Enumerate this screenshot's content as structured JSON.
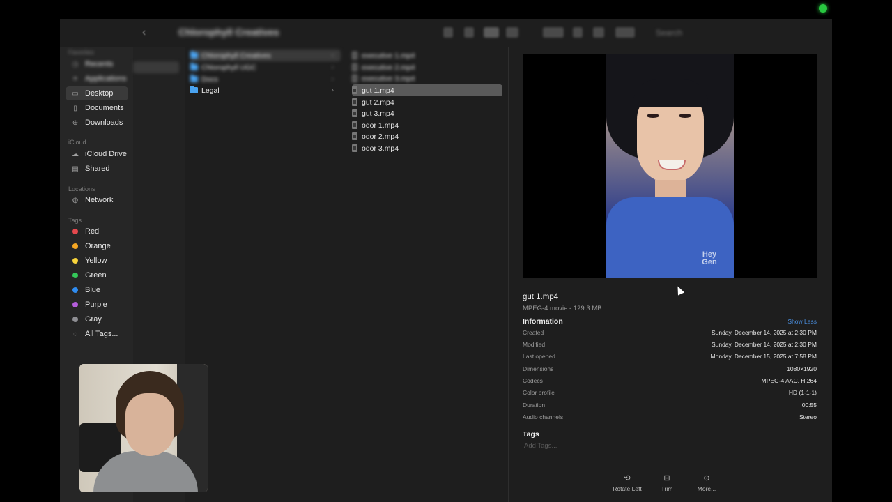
{
  "toolbar": {
    "folder_title": "Chlorophyll Creatives",
    "search_placeholder": "Search"
  },
  "sidebar": {
    "favorites_label": "Favorites",
    "favorites": [
      {
        "label": "Recents",
        "icon": "clock-icon"
      },
      {
        "label": "Applications",
        "icon": "applications-icon"
      },
      {
        "label": "Desktop",
        "icon": "desktop-icon"
      },
      {
        "label": "Documents",
        "icon": "document-icon"
      },
      {
        "label": "Downloads",
        "icon": "download-icon"
      }
    ],
    "icloud_label": "iCloud",
    "icloud": [
      {
        "label": "iCloud Drive",
        "icon": "cloud-icon"
      },
      {
        "label": "Shared",
        "icon": "shared-folder-icon"
      }
    ],
    "locations_label": "Locations",
    "locations": [
      {
        "label": "Network",
        "icon": "network-icon"
      }
    ],
    "tags_label": "Tags",
    "tags": [
      {
        "label": "Red",
        "color": "#e5484d"
      },
      {
        "label": "Orange",
        "color": "#f5a623"
      },
      {
        "label": "Yellow",
        "color": "#f7d33b"
      },
      {
        "label": "Green",
        "color": "#34c759"
      },
      {
        "label": "Blue",
        "color": "#2f8cf0"
      },
      {
        "label": "Purple",
        "color": "#b45ddb"
      },
      {
        "label": "Gray",
        "color": "#8e8e93"
      },
      {
        "label": "All Tags...",
        "icon": "tag-outline-icon"
      }
    ]
  },
  "column2": [
    {
      "label": "Chlorophyll Creatives",
      "blurred": true
    },
    {
      "label": "Chlorophyll UGC",
      "blurred": true
    },
    {
      "label": "Docs",
      "blurred": true
    },
    {
      "label": "Legal",
      "blurred": false
    }
  ],
  "column3": [
    {
      "label": "executive 1.mp4",
      "blurred": true
    },
    {
      "label": "executive 2.mp4",
      "blurred": true
    },
    {
      "label": "executive 3.mp4",
      "blurred": true
    },
    {
      "label": "gut 1.mp4",
      "selected": true
    },
    {
      "label": "gut 2.mp4"
    },
    {
      "label": "gut 3.mp4"
    },
    {
      "label": "odor 1.mp4"
    },
    {
      "label": "odor 2.mp4"
    },
    {
      "label": "odor 3.mp4"
    }
  ],
  "preview": {
    "watermark": "Hey Gen",
    "file_name": "gut 1.mp4",
    "file_kind": "MPEG-4 movie - 129.3 MB",
    "information_label": "Information",
    "show_less_label": "Show Less",
    "info": [
      {
        "key": "Created",
        "value": "Sunday, December 14, 2025 at 2:30 PM"
      },
      {
        "key": "Modified",
        "value": "Sunday, December 14, 2025 at 2:30 PM"
      },
      {
        "key": "Last opened",
        "value": "Monday, December 15, 2025 at 7:58 PM"
      },
      {
        "key": "Dimensions",
        "value": "1080×1920"
      },
      {
        "key": "Codecs",
        "value": "MPEG-4 AAC, H.264"
      },
      {
        "key": "Color profile",
        "value": "HD (1-1-1)"
      },
      {
        "key": "Duration",
        "value": "00:55"
      },
      {
        "key": "Audio channels",
        "value": "Stereo"
      }
    ],
    "tags_label": "Tags",
    "add_tags_placeholder": "Add Tags...",
    "actions": [
      {
        "label": "Rotate Left",
        "icon": "rotate-left-icon"
      },
      {
        "label": "Trim",
        "icon": "trim-icon"
      },
      {
        "label": "More...",
        "icon": "more-icon"
      }
    ]
  },
  "colors": {
    "accent": "#4a90e2",
    "folder": "#4aa3f0",
    "recording": "#28c840"
  }
}
